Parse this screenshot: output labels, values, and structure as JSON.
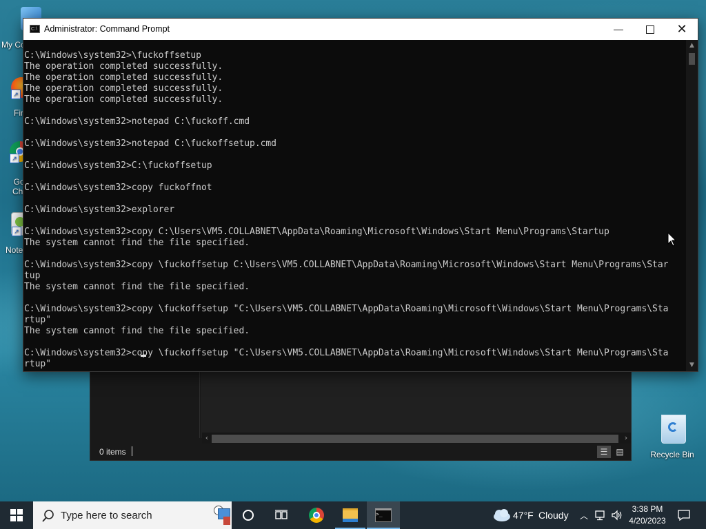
{
  "desktop": {
    "icons": [
      {
        "label": "My Co"
      },
      {
        "label": "Fir"
      },
      {
        "label": "Go\nChr"
      },
      {
        "label": "Note"
      },
      {
        "label": "Recycle Bin"
      }
    ]
  },
  "cmd": {
    "title": "Administrator: Command Prompt",
    "lines": [
      "C:\\Windows\\system32>\\fuckoffsetup",
      "The operation completed successfully.",
      "The operation completed successfully.",
      "The operation completed successfully.",
      "The operation completed successfully.",
      "",
      "C:\\Windows\\system32>notepad C:\\fuckoff.cmd",
      "",
      "C:\\Windows\\system32>notepad C:\\fuckoffsetup.cmd",
      "",
      "C:\\Windows\\system32>C:\\fuckoffsetup",
      "",
      "C:\\Windows\\system32>copy fuckoffnot",
      "",
      "C:\\Windows\\system32>explorer",
      "",
      "C:\\Windows\\system32>copy C:\\Users\\VM5.COLLABNET\\AppData\\Roaming\\Microsoft\\Windows\\Start Menu\\Programs\\Startup",
      "The system cannot find the file specified.",
      "",
      "C:\\Windows\\system32>copy \\fuckoffsetup C:\\Users\\VM5.COLLABNET\\AppData\\Roaming\\Microsoft\\Windows\\Start Menu\\Programs\\Star",
      "tup",
      "The system cannot find the file specified.",
      "",
      "C:\\Windows\\system32>copy \\fuckoffsetup \"C:\\Users\\VM5.COLLABNET\\AppData\\Roaming\\Microsoft\\Windows\\Start Menu\\Programs\\Sta",
      "rtup\"",
      "The system cannot find the file specified.",
      "",
      "C:\\Windows\\system32>copy \\fuckoffsetup \"C:\\Users\\VM5.COLLABNET\\AppData\\Roaming\\Microsoft\\Windows\\Start Menu\\Programs\\Sta",
      "rtup\""
    ]
  },
  "explorer": {
    "status": "0 items"
  },
  "taskbar": {
    "search_placeholder": "Type here to search",
    "weather_temp": "47°F",
    "weather_desc": "Cloudy",
    "time": "3:38 PM",
    "date": "4/20/2023"
  }
}
